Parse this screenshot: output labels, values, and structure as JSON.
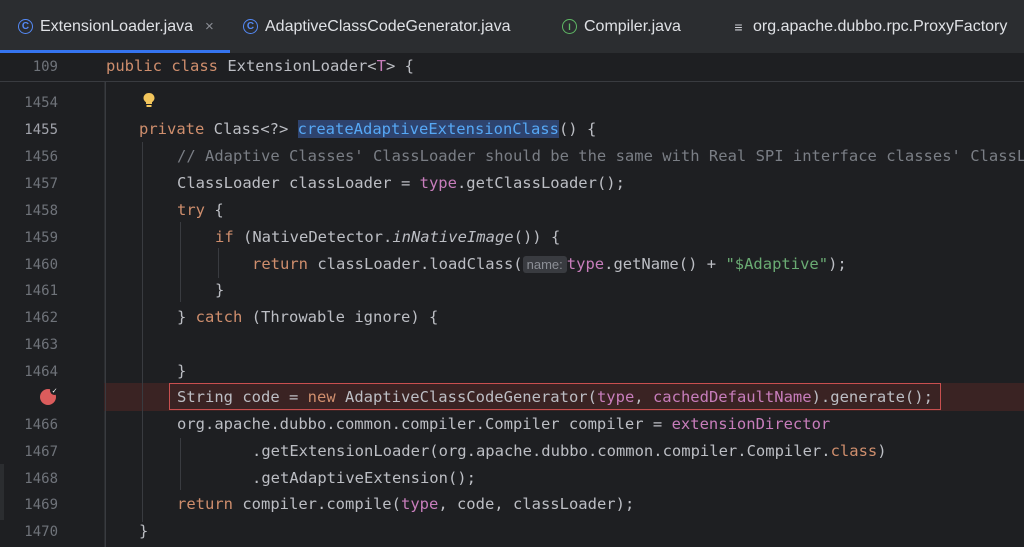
{
  "tabs": [
    {
      "label": "ExtensionLoader.java",
      "icon": "class-icon",
      "active": true,
      "close": "×"
    },
    {
      "label": "AdaptiveClassCodeGenerator.java",
      "icon": "class-icon",
      "active": false
    },
    {
      "label": "Compiler.java",
      "icon": "interface-icon",
      "active": false
    },
    {
      "label": "org.apache.dubbo.rpc.ProxyFactory",
      "icon": "file-lines-icon",
      "active": false
    }
  ],
  "sticky": {
    "line": "109",
    "code": "public class ExtensionLoader<T> {"
  },
  "lines": [
    {
      "n": "1454"
    },
    {
      "n": "1455"
    },
    {
      "n": "1456"
    },
    {
      "n": "1457"
    },
    {
      "n": "1458"
    },
    {
      "n": "1459"
    },
    {
      "n": "1460"
    },
    {
      "n": "1461"
    },
    {
      "n": "1462"
    },
    {
      "n": "1463"
    },
    {
      "n": "1464"
    },
    {
      "n": ""
    },
    {
      "n": "1466"
    },
    {
      "n": "1467"
    },
    {
      "n": "1468"
    },
    {
      "n": "1469"
    },
    {
      "n": "1470"
    }
  ],
  "code": {
    "l1455_kw": "private",
    "l1455_type": "Class<?>",
    "l1455_fn": "createAdaptiveExtensionClass",
    "l1455_rest": "() {",
    "l1456": "// Adaptive Classes' ClassLoader should be the same with Real SPI interface classes' ClassL",
    "l1457_a": "ClassLoader classLoader = ",
    "l1457_b": "type",
    "l1457_c": ".getClassLoader();",
    "l1458_kw": "try",
    "l1458_rest": " {",
    "l1459_kw": "if",
    "l1459_a": " (NativeDetector.",
    "l1459_it": "inNativeImage",
    "l1459_b": "()) {",
    "l1460_kw": "return",
    "l1460_a": " classLoader.loadClass(",
    "l1460_hint": "name:",
    "l1460_b": "type",
    "l1460_c": ".getName() + ",
    "l1460_str": "\"$Adaptive\"",
    "l1460_d": ");",
    "l1461": "}",
    "l1462_a": "} ",
    "l1462_kw": "catch",
    "l1462_b": " (Throwable ignore) {",
    "l1464": "}",
    "l1465_a": "String code = ",
    "l1465_kw": "new",
    "l1465_b": " AdaptiveClassCodeGenerator(",
    "l1465_p1": "type",
    "l1465_c": ", ",
    "l1465_p2": "cachedDefaultName",
    "l1465_d": ").generate();",
    "l1466_a": "org.apache.dubbo.common.compiler.Compiler compiler = ",
    "l1466_p": "extensionDirector",
    "l1467_a": ".getExtensionLoader(org.apache.dubbo.common.compiler.Compiler.",
    "l1467_kw": "class",
    "l1467_b": ")",
    "l1468": ".getAdaptiveExtension();",
    "l1469_kw": "return",
    "l1469_a": " compiler.compile(",
    "l1469_p": "type",
    "l1469_b": ", code, classLoader);",
    "l1470": "}"
  },
  "colors": {
    "accent": "#3574f0",
    "breakpoint": "#db5c5c",
    "keyword": "#cf8e6d",
    "method": "#56a8f5",
    "string": "#6aab73",
    "field": "#c77dbb"
  }
}
